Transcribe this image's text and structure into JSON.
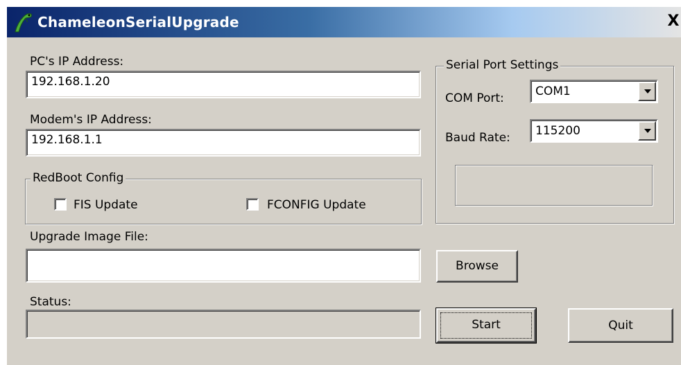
{
  "window": {
    "title": "ChameleonSerialUpgrade",
    "close_label": "X"
  },
  "form": {
    "pc_ip_label": "PC's IP Address:",
    "pc_ip_value": "192.168.1.20",
    "modem_ip_label": "Modem's IP Address:",
    "modem_ip_value": "192.168.1.1",
    "upgrade_file_label": "Upgrade Image File:",
    "upgrade_file_value": "",
    "status_label": "Status:",
    "status_value": ""
  },
  "redboot": {
    "title": "RedBoot Config",
    "fis_label": "FIS Update",
    "fis_checked": false,
    "fconfig_label": "FCONFIG Update",
    "fconfig_checked": false
  },
  "serial": {
    "title": "Serial Port Settings",
    "com_port_label": "COM Port:",
    "com_port_value": "COM1",
    "baud_rate_label": "Baud Rate:",
    "baud_rate_value": "115200"
  },
  "buttons": {
    "browse": "Browse",
    "start": "Start",
    "quit": "Quit"
  },
  "icons": {
    "app": "chameleon-icon",
    "dropdown": "chevron-down-icon"
  }
}
